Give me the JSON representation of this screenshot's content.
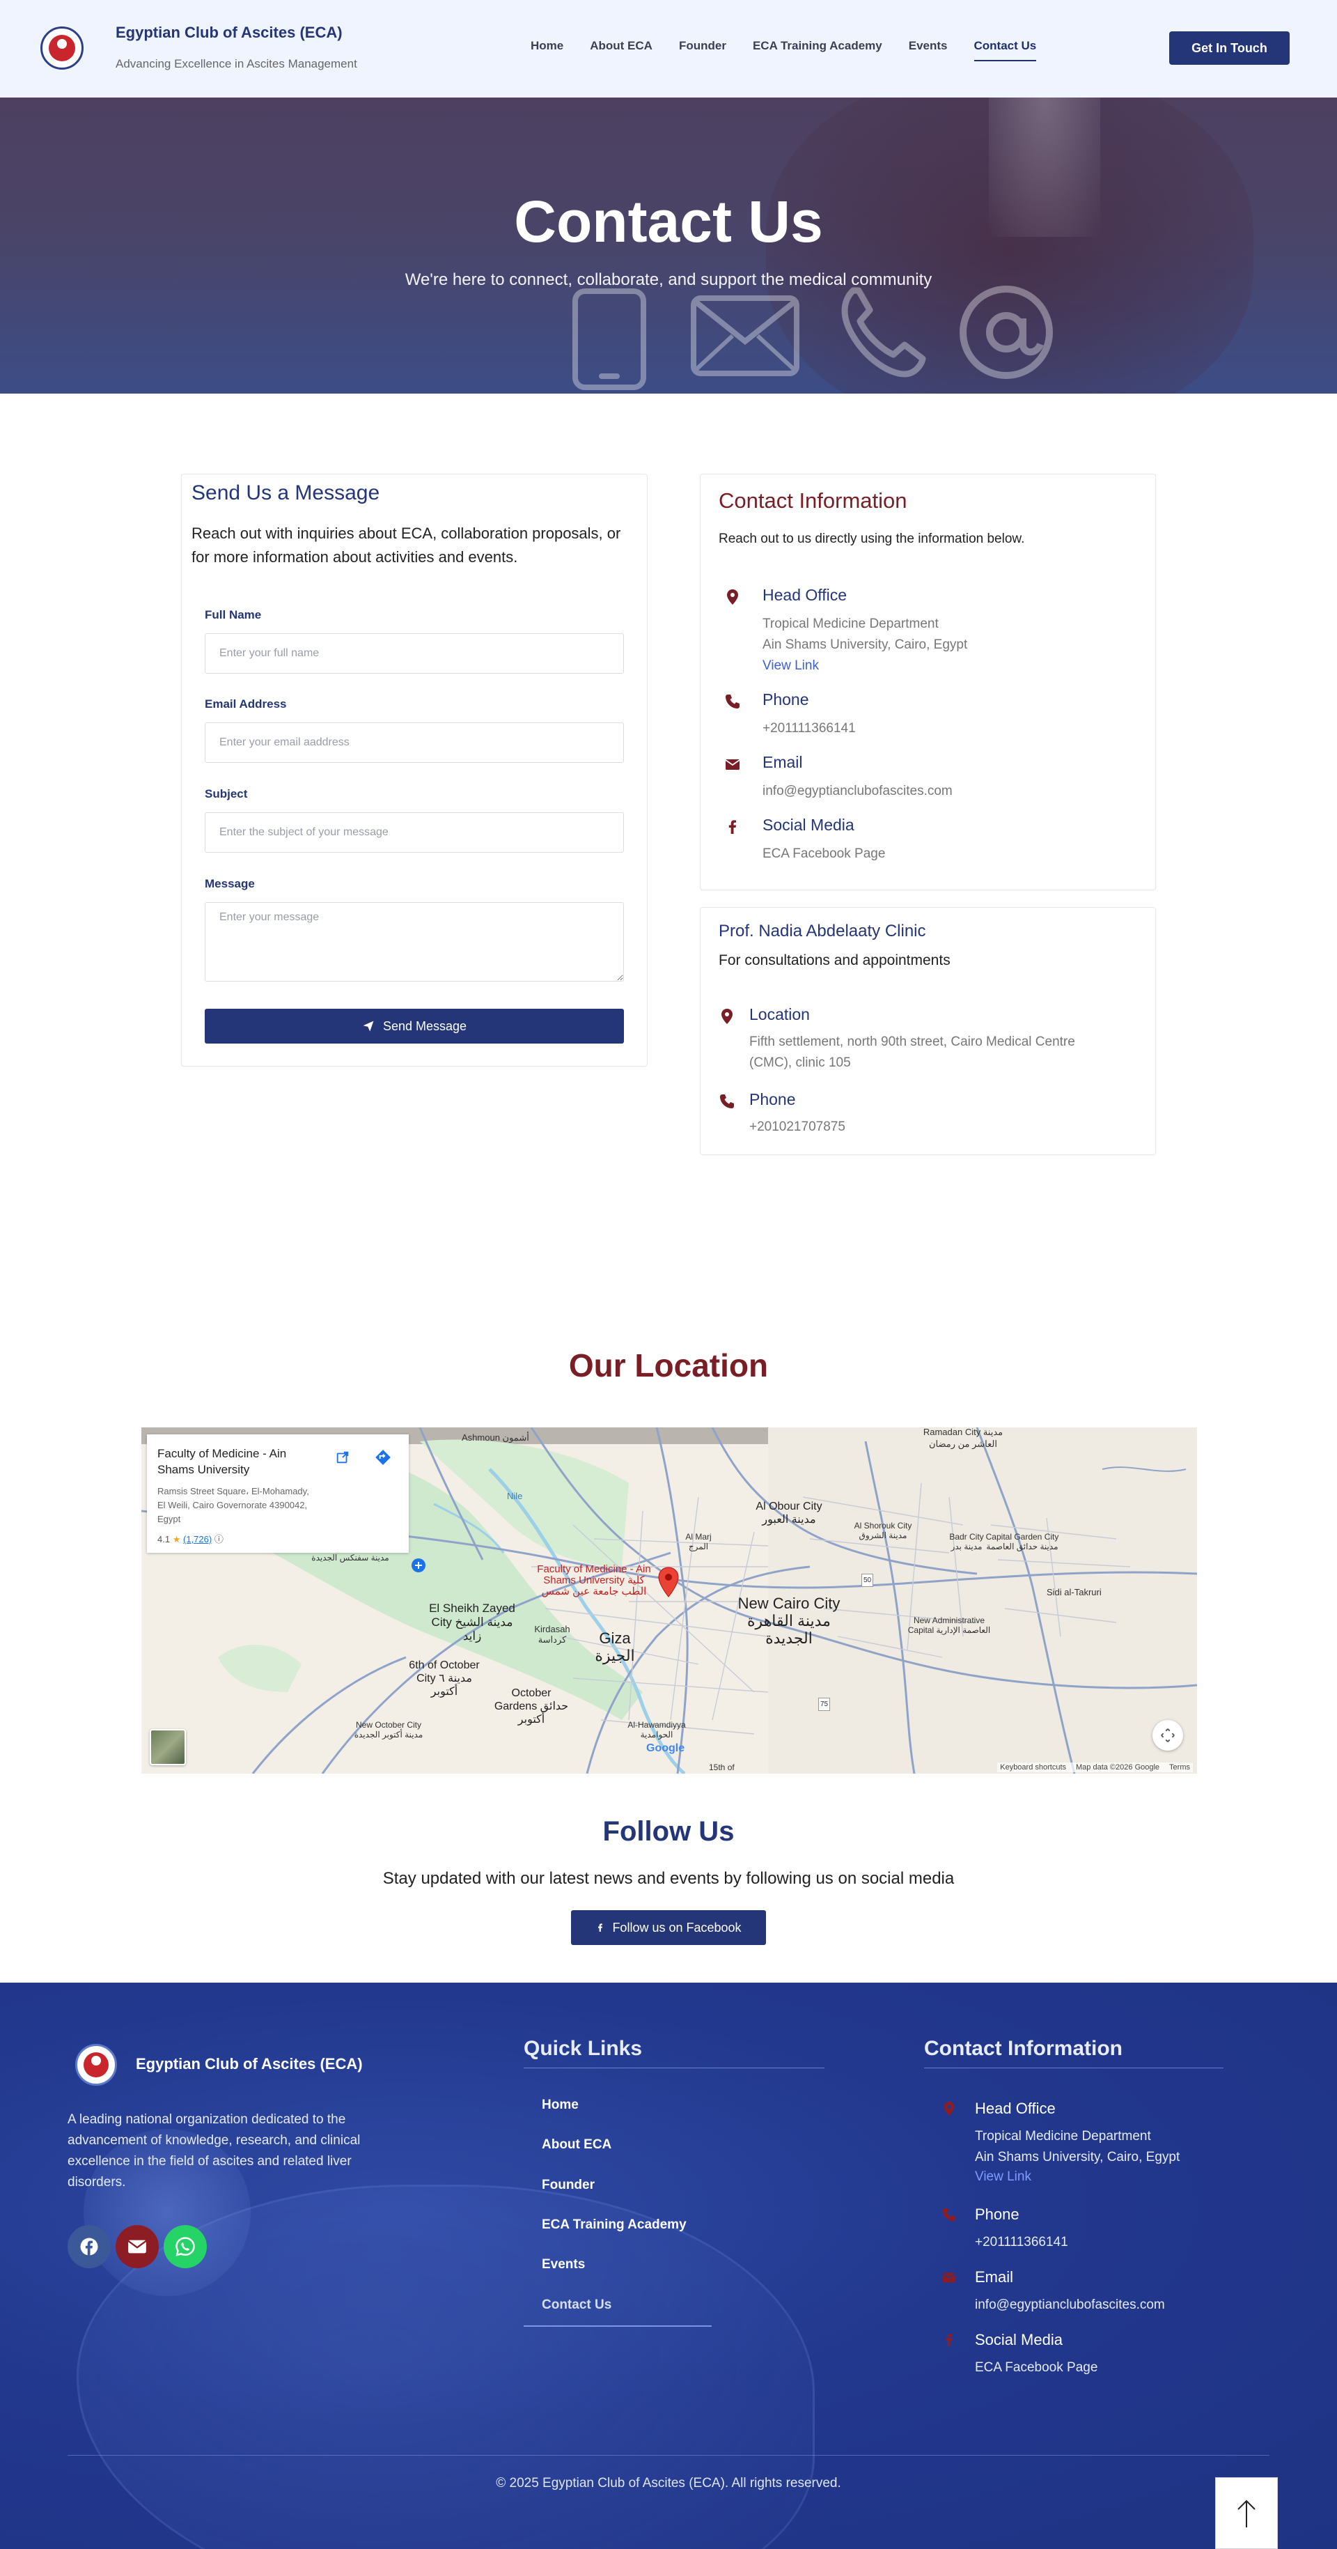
{
  "header": {
    "brand_title": "Egyptian Club of Ascites (ECA)",
    "brand_subtitle": "Advancing Excellence in Ascites Management",
    "nav": [
      "Home",
      "About ECA",
      "Founder",
      "ECA Training Academy",
      "Events",
      "Contact Us"
    ],
    "active_nav": "Contact Us",
    "cta_label": "Get In Touch"
  },
  "hero": {
    "title": "Contact Us",
    "subtitle": "We're here to connect, collaborate, and support the medical community"
  },
  "form": {
    "title": "Send Us a Message",
    "intro": "Reach out with inquiries about ECA, collaboration proposals, or for more information about activities and events.",
    "fields": [
      {
        "label": "Full Name",
        "placeholder": "Enter your full name",
        "value": ""
      },
      {
        "label": "Email Address",
        "placeholder": "Enter your email aaddress",
        "value": ""
      },
      {
        "label": "Subject",
        "placeholder": "Enter the subject of your message",
        "value": ""
      },
      {
        "label": "Message",
        "placeholder": "Enter your message",
        "value": ""
      }
    ],
    "submit_label": "Send Message"
  },
  "contact_info": {
    "title": "Contact Information",
    "intro": "Reach out to us directly using the information below.",
    "head_office": {
      "title": "Head Office",
      "line1": "Tropical Medicine Department",
      "line2": "Ain Shams University, Cairo, Egypt",
      "link": "View Link"
    },
    "phone": {
      "title": "Phone",
      "value": "+201111366141"
    },
    "email": {
      "title": "Email",
      "value": "info@egyptianclubofascites.com"
    },
    "social": {
      "title": "Social Media",
      "value": "ECA Facebook Page"
    }
  },
  "clinic": {
    "title": "Prof. Nadia Abdelaaty Clinic",
    "intro": "For consultations and appointments",
    "location": {
      "title": "Location",
      "line1": "Fifth settlement, north 90th street, Cairo Medical Centre",
      "line2": "(CMC), clinic 105"
    },
    "phone": {
      "title": "Phone",
      "value": "+201021707875"
    }
  },
  "location": {
    "title": "Our Location",
    "map_card": {
      "name": "Faculty of Medicine - Ain Shams University",
      "address": "Ramsis Street Square، El-Mohamady, El Weili, Cairo Governorate 4390042, Egypt",
      "rating": "4.1",
      "reviews": "(1,726)"
    },
    "labels": {
      "ashmoun": "Ashmoun أشمون",
      "alobour": "Al Obour City مدينة العبور",
      "ramadan": "Ramadan City مدينة العاشر من رمضان",
      "alshorouk": "Al Shorouk City مدينة الشروق",
      "badr": "Badr City مدينة بدر",
      "capital_garden": "Capital Garden City مدينة حدائق العاصمة",
      "sidi": "Sidi al-Takruri",
      "almarj": "Al Marj المرج",
      "sheikh_zayed": "El Sheikh Zayed City مدينة الشيخ زايد",
      "kirdasah": "Kirdasah كرداسة",
      "giza": "Giza الجيزة",
      "new_cairo": "New Cairo City مدينة القاهرة الجديدة",
      "new_admin": "New Administrative Capital العاصمة الإدارية",
      "october": "6th of October City مدينة ٦ أكتوبر",
      "october_gardens": "October Gardens حدائق أكتوبر",
      "new_october": "New October City مدينة أكتوبر الجديدة",
      "hawamdiyya": "Al-Hawamdiyya الحوامدية",
      "sadat": "مدينة سفنكس الجديدة",
      "faculty_pin": "Faculty of Medicine - Ain Shams University كلية الطب جامعة عين شمس",
      "nile": "Nile",
      "fifteenth": "15th of",
      "road_50": "50",
      "road_75": "75"
    },
    "footer_links": [
      "Keyboard shortcuts",
      "Map data ©2026 Google",
      "Terms"
    ],
    "google": "Google"
  },
  "follow": {
    "title": "Follow Us",
    "subtitle": "Stay updated with our latest news and events by following us on social media",
    "button_label": "Follow us on Facebook"
  },
  "footer": {
    "brand": "Egyptian Club of Ascites (ECA)",
    "description": "A leading national organization dedicated to the advancement of knowledge, research, and clinical excellence in the field of ascites and related liver disorders.",
    "quick_links_title": "Quick Links",
    "quick_links": [
      "Home",
      "About ECA",
      "Founder",
      "ECA Training Academy",
      "Events",
      "Contact Us"
    ],
    "contact_title": "Contact Information",
    "head_office": {
      "title": "Head Office",
      "line1": "Tropical Medicine Department",
      "line2": "Ain Shams University, Cairo, Egypt",
      "link": "View Link"
    },
    "phone": {
      "title": "Phone",
      "value": "+201111366141"
    },
    "email": {
      "title": "Email",
      "value": "info@egyptianclubofascites.com"
    },
    "social": {
      "title": "Social Media",
      "value": "ECA Facebook Page"
    },
    "copyright": "© 2025 Egyptian Club of Ascites (ECA). All rights reserved."
  },
  "colors": {
    "primary": "#243578",
    "accent": "#7a1e26",
    "facebook": "#3b5998",
    "mail": "#8c1d24",
    "whatsapp": "#25d366"
  },
  "icons": [
    "map-pin-icon",
    "phone-icon",
    "envelope-icon",
    "facebook-icon",
    "paper-plane-icon",
    "whatsapp-icon",
    "arrow-up-icon",
    "directions-icon",
    "external-link-icon",
    "fullscreen-icon"
  ]
}
